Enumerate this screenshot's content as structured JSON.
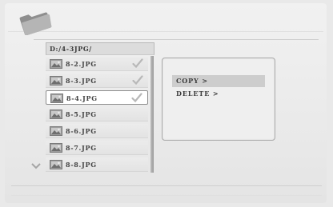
{
  "path": "D:/4-3JPG/",
  "files": [
    {
      "name": "8-2.JPG",
      "checked": true,
      "selected": false
    },
    {
      "name": "8-3.JPG",
      "checked": true,
      "selected": false
    },
    {
      "name": "8-4.JPG",
      "checked": true,
      "selected": true
    },
    {
      "name": "8-5.JPG",
      "checked": false,
      "selected": false
    },
    {
      "name": "8-6.JPG",
      "checked": false,
      "selected": false
    },
    {
      "name": "8-7.JPG",
      "checked": false,
      "selected": false
    },
    {
      "name": "8-8.JPG",
      "checked": false,
      "selected": false
    }
  ],
  "menu": {
    "copy_label": "COPY >",
    "delete_label": "DELETE >",
    "highlighted": "copy"
  },
  "icons": {
    "top_left": "folder-icon",
    "file": "image-file-icon",
    "mark": "checkmark-icon",
    "scroll": "chevron-down-icon"
  },
  "colors": {
    "background": "#ebebeb",
    "highlight": "#cdcdcd",
    "border": "#a9a9a9"
  }
}
